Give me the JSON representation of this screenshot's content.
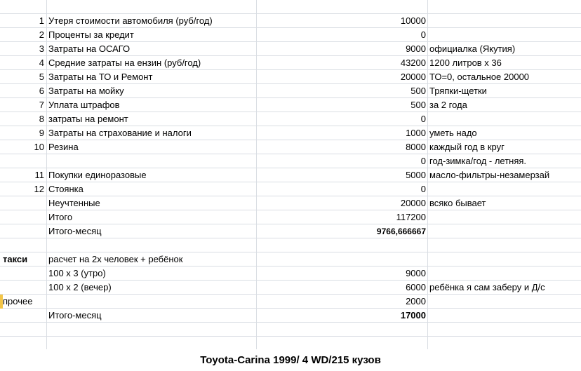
{
  "rows": [
    {
      "a": "",
      "b": "",
      "c": "",
      "d": ""
    },
    {
      "a": "1",
      "b": "Утеря стоимости автомобиля (руб/год)",
      "c": "10000",
      "d": ""
    },
    {
      "a": "2",
      "b": "Проценты за кредит",
      "c": "0",
      "d": ""
    },
    {
      "a": "3",
      "b": "Затраты на ОСАГО",
      "c": "9000",
      "d": "официалка (Якутия)"
    },
    {
      "a": "4",
      "b": "Средние затраты на ензин (руб/год)",
      "c": "43200",
      "d": "1200 литров х 36"
    },
    {
      "a": "5",
      "b": "Затраты на ТО и Ремонт",
      "c": "20000",
      "d": "ТО=0, остальное 20000"
    },
    {
      "a": "6",
      "b": "Затраты на мойку",
      "c": "500",
      "d": "Тряпки-щетки"
    },
    {
      "a": "7",
      "b": "Уплата штрафов",
      "c": "500",
      "d": "за 2 года"
    },
    {
      "a": "8",
      "b": "затраты на ремонт",
      "c": "0",
      "d": ""
    },
    {
      "a": "9",
      "b": "Затраты на страхование и налоги",
      "c": "1000",
      "d": "уметь надо"
    },
    {
      "a": "10",
      "b": "Резина",
      "c": "8000",
      "d": "каждый год в круг"
    },
    {
      "a": "",
      "b": "",
      "c": "0",
      "d": "год-зимка/год - летняя."
    },
    {
      "a": "11",
      "b": "Покупки единоразовые",
      "c": "5000",
      "d": "масло-фильтры-незамерзай"
    },
    {
      "a": "12",
      "b": "Стоянка",
      "c": "0",
      "d": ""
    },
    {
      "a": "",
      "b": "Неучтенные",
      "c": "20000",
      "d": "всяко бывает"
    },
    {
      "a": "",
      "b": "Итого",
      "c": "117200",
      "d": ""
    },
    {
      "a": "",
      "b": "Итого-месяц",
      "c": "9766,666667",
      "d": ""
    },
    {
      "a": "",
      "b": "",
      "c": "",
      "d": ""
    },
    {
      "a": "такси",
      "b": "расчет на 2х человек + ребёнок",
      "c": "",
      "d": ""
    },
    {
      "a": "",
      "b": "100 х 3 (утро)",
      "c": "9000",
      "d": ""
    },
    {
      "a": "",
      "b": "100 х 2 (вечер)",
      "c": "6000",
      "d": "ребёнка я сам заберу и Д/с"
    },
    {
      "a": "прочее",
      "b": "",
      "c": "2000",
      "d": ""
    },
    {
      "a": "",
      "b": "Итого-месяц",
      "c": "17000",
      "d": ""
    },
    {
      "a": "",
      "b": "",
      "c": "",
      "d": ""
    },
    {
      "a": "",
      "b": "",
      "c": "",
      "d": ""
    }
  ],
  "footer_title": "Toyota-Carina 1999/ 4 WD/215 кузов"
}
